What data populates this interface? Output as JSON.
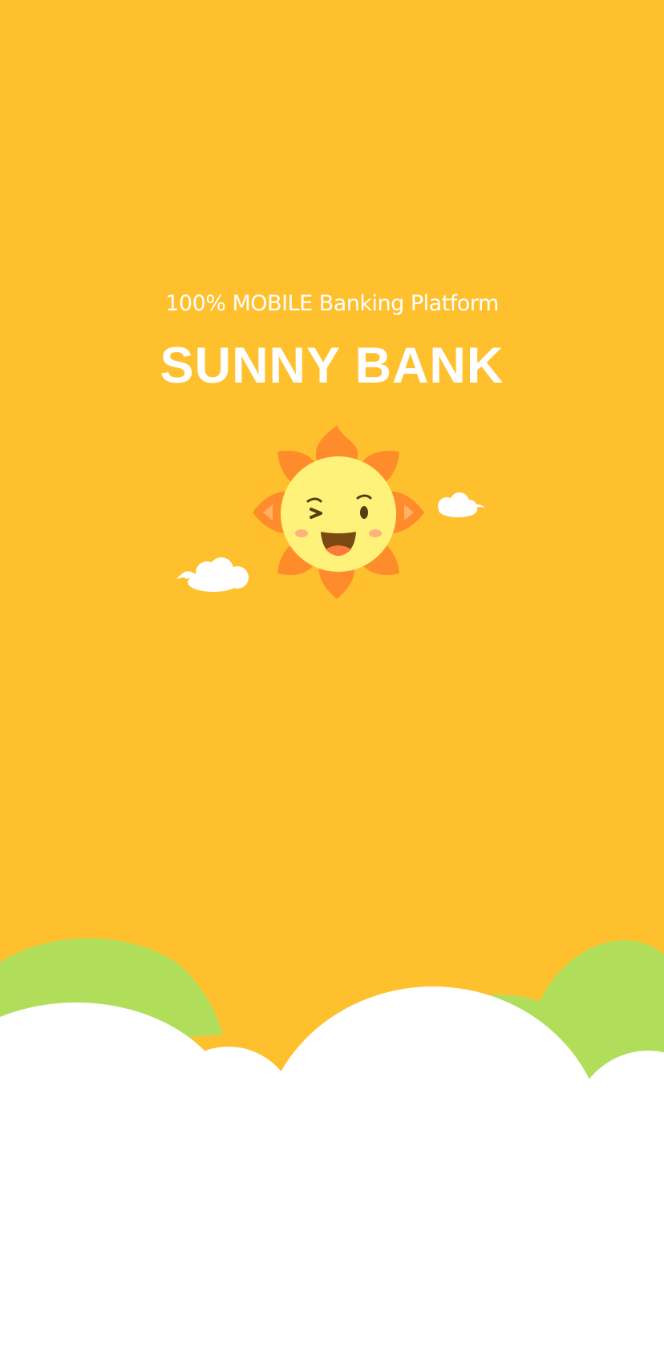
{
  "splash": {
    "tagline": "100% MOBILE Banking Platform",
    "brand_name": "SUNNY BANK"
  },
  "colors": {
    "background": "#FFC02D",
    "text": "#FFFFFF",
    "hills": "#B1DE5A",
    "ground_clouds": "#FFFFFF",
    "sun_petals": "#FF8C2A",
    "sun_face": "#FFF27A"
  },
  "icons": {
    "mascot": "sun-mascot-icon",
    "left_cloud": "cloud-icon",
    "right_cloud": "cloud-icon"
  }
}
